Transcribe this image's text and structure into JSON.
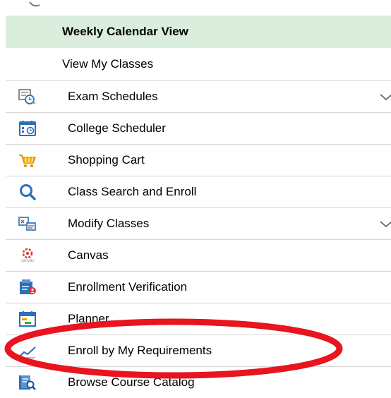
{
  "menu": {
    "sub_items": [
      {
        "label": "Weekly Calendar View",
        "active": true
      },
      {
        "label": "View My Classes",
        "active": false
      }
    ],
    "items": [
      {
        "label": "Exam Schedules",
        "icon": "exam-clock-icon",
        "expandable": true
      },
      {
        "label": "College Scheduler",
        "icon": "calendar-clock-icon",
        "expandable": false
      },
      {
        "label": "Shopping Cart",
        "icon": "shopping-cart-icon",
        "expandable": false
      },
      {
        "label": "Class Search and Enroll",
        "icon": "search-icon",
        "expandable": false
      },
      {
        "label": "Modify Classes",
        "icon": "modify-classes-icon",
        "expandable": true
      },
      {
        "label": "Canvas",
        "icon": "canvas-logo-icon",
        "expandable": false
      },
      {
        "label": "Enrollment Verification",
        "icon": "enrollment-verification-icon",
        "expandable": false
      },
      {
        "label": "Planner",
        "icon": "planner-icon",
        "expandable": false
      },
      {
        "label": "Enroll by My Requirements",
        "icon": "trend-line-icon",
        "expandable": false
      },
      {
        "label": "Browse Course Catalog",
        "icon": "catalog-search-icon",
        "expandable": false
      }
    ]
  },
  "icon_text": {
    "canvas_small": "canvas"
  },
  "colors": {
    "active_bg": "#dbeede",
    "highlight_ring": "#e8141e",
    "icon_blue": "#2d6fb8",
    "icon_orange": "#f0a000",
    "canvas_red": "#e4302b"
  }
}
